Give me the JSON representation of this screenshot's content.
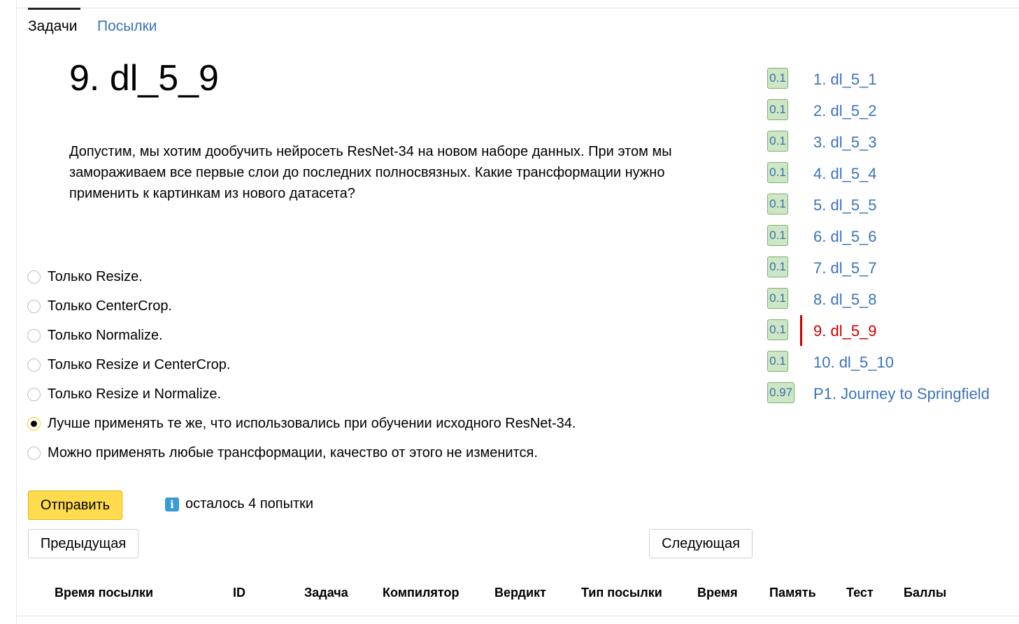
{
  "tabs": [
    {
      "label": "Задачи",
      "active": true
    },
    {
      "label": "Посылки",
      "active": false
    }
  ],
  "problem": {
    "title": "9. dl_5_9",
    "statement": "Допустим, мы хотим дообучить нейросеть ResNet-34 на новом наборе данных. При этом мы замораживаем все первые слои до последних полносвязных. Какие трансформации нужно применить к картинкам из нового датасета?"
  },
  "options": [
    {
      "label": "Только Resize.",
      "checked": false
    },
    {
      "label": "Только CenterCrop.",
      "checked": false
    },
    {
      "label": "Только Normalize.",
      "checked": false
    },
    {
      "label": "Только Resize и CenterCrop.",
      "checked": false
    },
    {
      "label": "Только Resize и Normalize.",
      "checked": false
    },
    {
      "label": "Лучше применять те же, что использовались при обучении исходного ResNet-34.",
      "checked": true
    },
    {
      "label": "Можно применять любые трансформации, качество от этого не изменится.",
      "checked": false
    }
  ],
  "actions": {
    "submit_label": "Отправить",
    "info_icon": "i",
    "attempts_text": "осталось 4 попытки",
    "prev_label": "Предыдущая",
    "next_label": "Следующая"
  },
  "submissions_table": {
    "columns": [
      "Время посылки",
      "ID",
      "Задача",
      "Компилятор",
      "Вердикт",
      "Тип посылки",
      "Время",
      "Память",
      "Тест",
      "Баллы"
    ]
  },
  "problem_list": [
    {
      "score": "0.1",
      "label": "1. dl_5_1",
      "active": false
    },
    {
      "score": "0.1",
      "label": "2. dl_5_2",
      "active": false
    },
    {
      "score": "0.1",
      "label": "3. dl_5_3",
      "active": false
    },
    {
      "score": "0.1",
      "label": "4. dl_5_4",
      "active": false
    },
    {
      "score": "0.1",
      "label": "5. dl_5_5",
      "active": false
    },
    {
      "score": "0.1",
      "label": "6. dl_5_6",
      "active": false
    },
    {
      "score": "0.1",
      "label": "7. dl_5_7",
      "active": false
    },
    {
      "score": "0.1",
      "label": "8. dl_5_8",
      "active": false
    },
    {
      "score": "0.1",
      "label": "9. dl_5_9",
      "active": true
    },
    {
      "score": "0.1",
      "label": "10. dl_5_10",
      "active": false
    },
    {
      "score": "0.97",
      "label": "P1. Journey to Springfield",
      "active": false
    }
  ],
  "colors": {
    "link": "#3b73b9",
    "active": "#cc0000",
    "submit": "#ffdb4d",
    "score_bg": "#cde6c5",
    "info": "#3a9bd6"
  }
}
